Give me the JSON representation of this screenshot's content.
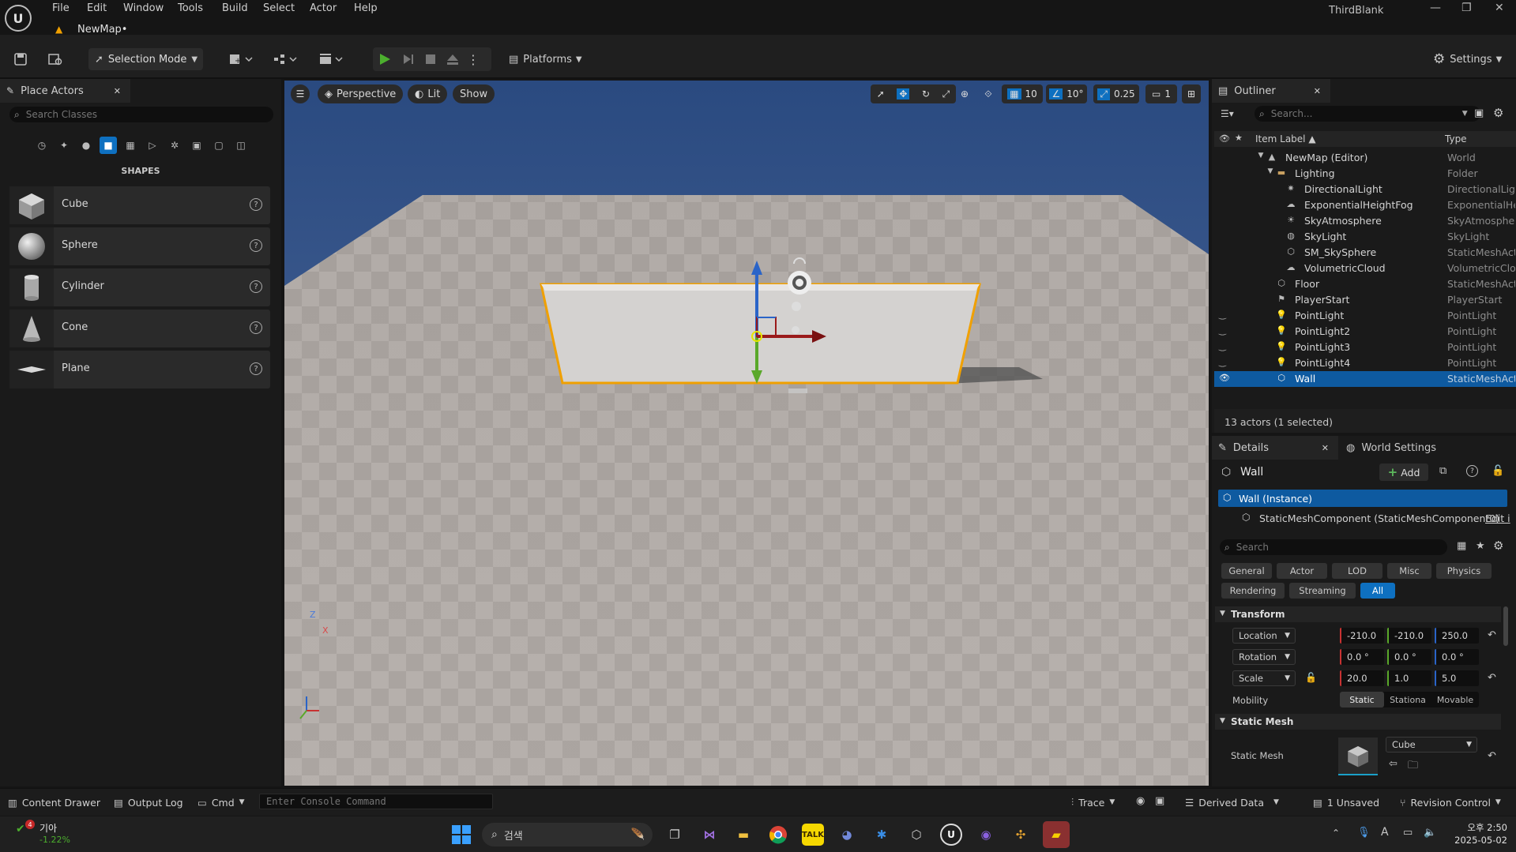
{
  "app": {
    "project_name": "ThirdBlank",
    "map_tab": "NewMap•"
  },
  "menu": [
    "File",
    "Edit",
    "Window",
    "Tools",
    "Build",
    "Select",
    "Actor",
    "Help"
  ],
  "toolbar": {
    "selection_mode": "Selection Mode",
    "platforms": "Platforms",
    "settings": "Settings"
  },
  "place_actors": {
    "tab_label": "Place Actors",
    "search_placeholder": "Search Classes",
    "section": "SHAPES",
    "items": [
      {
        "label": "Cube"
      },
      {
        "label": "Sphere"
      },
      {
        "label": "Cylinder"
      },
      {
        "label": "Cone"
      },
      {
        "label": "Plane"
      }
    ]
  },
  "viewport": {
    "perspective": "Perspective",
    "lit": "Lit",
    "show": "Show",
    "grid_snap": "10",
    "rotation_snap": "10°",
    "scale_snap": "0.25",
    "camera_speed": "1",
    "axis_x": "X",
    "axis_z": "Z"
  },
  "outliner": {
    "tab_label": "Outliner",
    "search_placeholder": "Search...",
    "col_label": "Item Label ▲",
    "col_type": "Type",
    "items": [
      {
        "label": "NewMap (Editor)",
        "type": "World"
      },
      {
        "label": "Lighting",
        "type": "Folder"
      },
      {
        "label": "DirectionalLight",
        "type": "DirectionalLigh"
      },
      {
        "label": "ExponentialHeightFog",
        "type": "ExponentialHei"
      },
      {
        "label": "SkyAtmosphere",
        "type": "SkyAtmospher"
      },
      {
        "label": "SkyLight",
        "type": "SkyLight"
      },
      {
        "label": "SM_SkySphere",
        "type": "StaticMeshActo"
      },
      {
        "label": "VolumetricCloud",
        "type": "VolumetricClou"
      },
      {
        "label": "Floor",
        "type": "StaticMeshActo"
      },
      {
        "label": "PlayerStart",
        "type": "PlayerStart"
      },
      {
        "label": "PointLight",
        "type": "PointLight"
      },
      {
        "label": "PointLight2",
        "type": "PointLight"
      },
      {
        "label": "PointLight3",
        "type": "PointLight"
      },
      {
        "label": "PointLight4",
        "type": "PointLight"
      },
      {
        "label": "Wall",
        "type": "StaticMeshActo"
      }
    ],
    "status": "13 actors (1 selected)"
  },
  "details": {
    "tab_label": "Details",
    "world_settings_label": "World Settings",
    "actor_name": "Wall",
    "add_label": "Add",
    "instance_label": "Wall (Instance)",
    "component_label": "StaticMeshComponent (StaticMeshComponent0)",
    "edit_link": "Edit i",
    "search_placeholder": "Search",
    "categories_row1": [
      "General",
      "Actor",
      "LOD",
      "Misc",
      "Physics"
    ],
    "categories_row2": [
      "Rendering",
      "Streaming",
      "All"
    ],
    "transform_header": "Transform",
    "location": {
      "label": "Location",
      "x": "-210.0",
      "y": "-210.0",
      "z": "250.0"
    },
    "rotation": {
      "label": "Rotation",
      "x": "0.0 °",
      "y": "0.0 °",
      "z": "0.0 °"
    },
    "scale": {
      "label": "Scale",
      "x": "20.0",
      "y": "1.0",
      "z": "5.0"
    },
    "mobility": {
      "label": "Mobility",
      "options": [
        "Static",
        "Stationa",
        "Movable"
      ],
      "selected": "Static"
    },
    "static_mesh_header": "Static Mesh",
    "static_mesh_label": "Static Mesh",
    "static_mesh_value": "Cube"
  },
  "bottombar": {
    "content_drawer": "Content Drawer",
    "output_log": "Output Log",
    "cmd": "Cmd",
    "console_placeholder": "Enter Console Command",
    "trace": "Trace",
    "derived_data": "Derived Data",
    "unsaved": "1 Unsaved",
    "revision_control": "Revision Control"
  },
  "taskbar": {
    "stock_name": "기아",
    "stock_change": "-1.22%",
    "stock_badge": "4",
    "search_placeholder": "검색",
    "time": "오후 2:50",
    "date": "2025-05-02"
  },
  "colors": {
    "accent": "#0e70c0",
    "selection_outline": "#f0a000",
    "sky": "#2f4f86"
  }
}
